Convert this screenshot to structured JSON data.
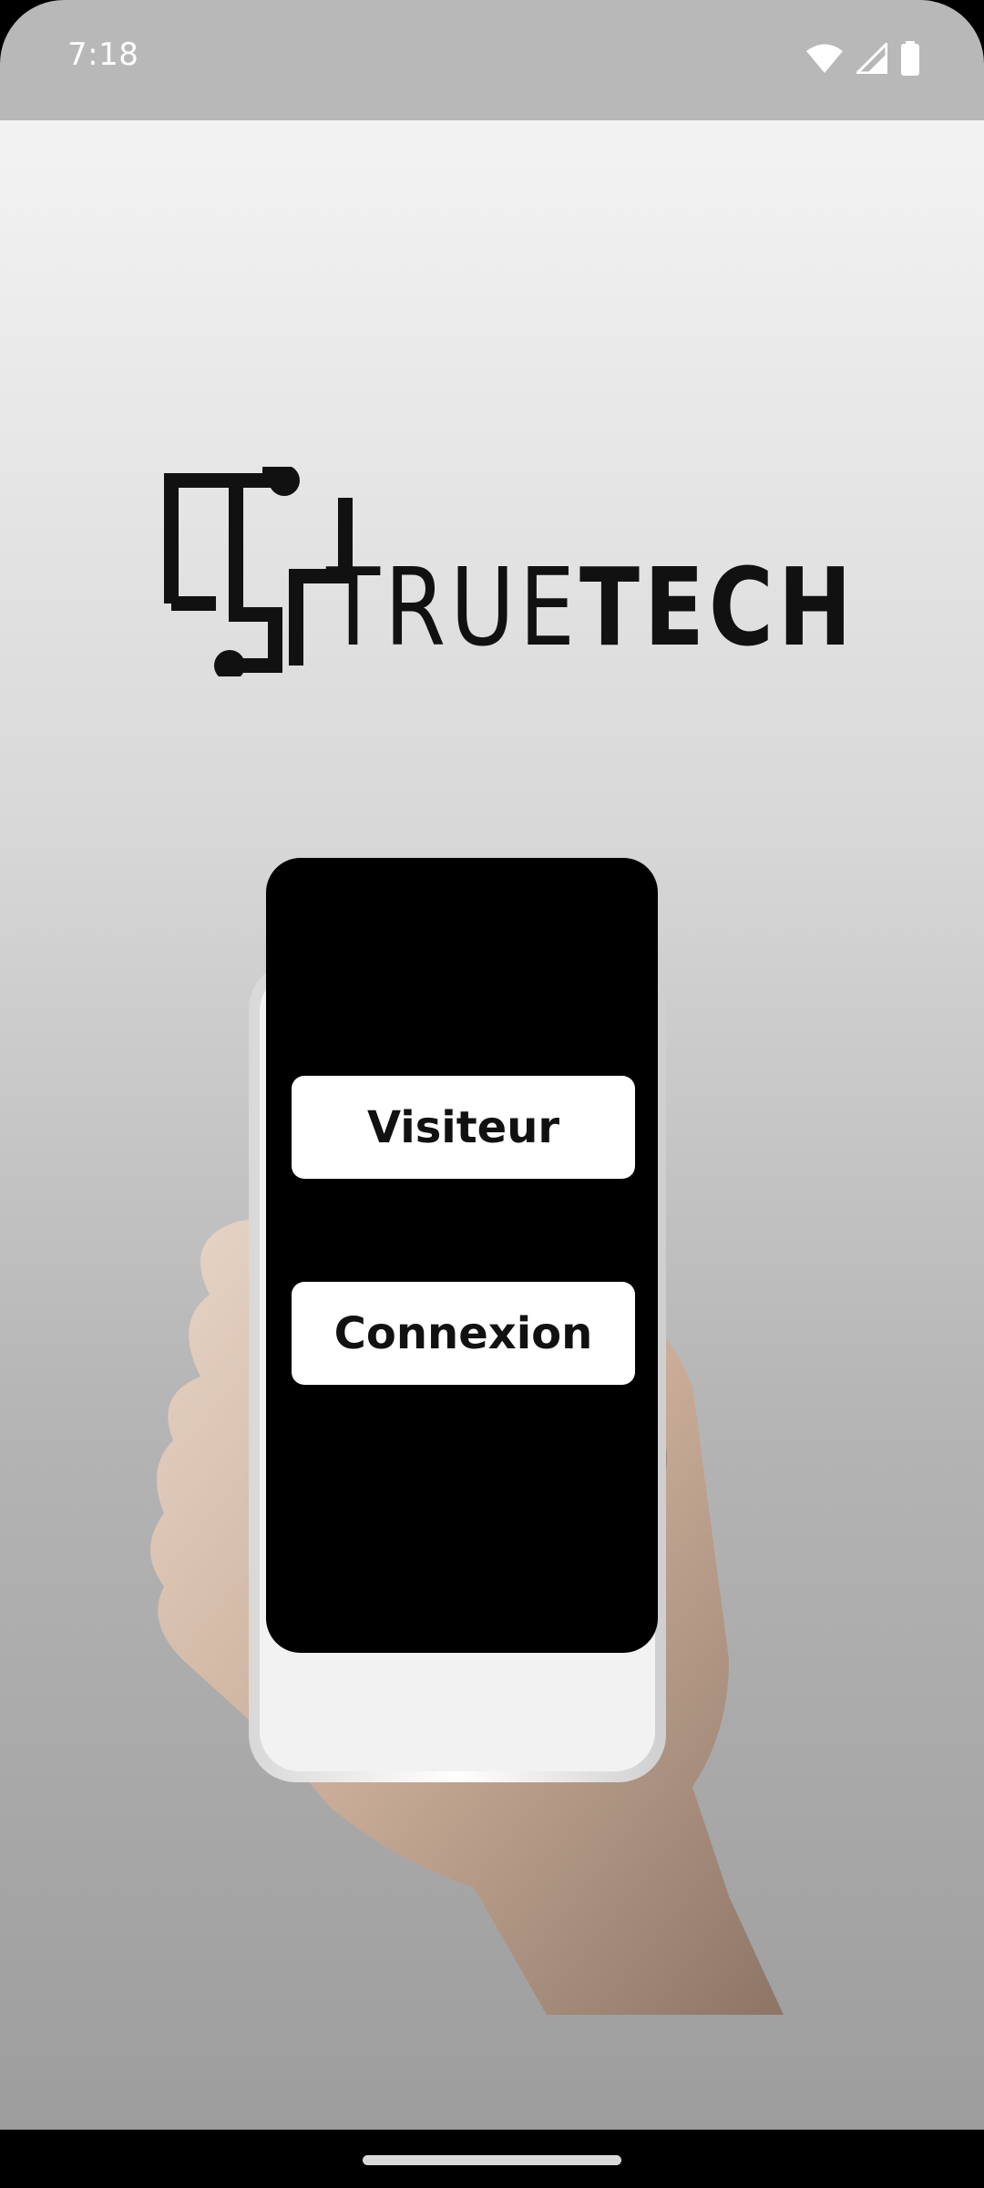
{
  "status_bar": {
    "time": "7:18",
    "icons": [
      "wifi-icon",
      "cell-signal-icon",
      "battery-icon"
    ]
  },
  "logo": {
    "word_light": "TRUE",
    "word_bold": "TECH"
  },
  "buttons": {
    "visitor_label": "Visiteur",
    "login_label": "Connexion"
  },
  "colors": {
    "status_bar": "#b8b8b8",
    "button_bg": "#ffffff",
    "phone_screen": "#000000",
    "text": "#111111"
  }
}
